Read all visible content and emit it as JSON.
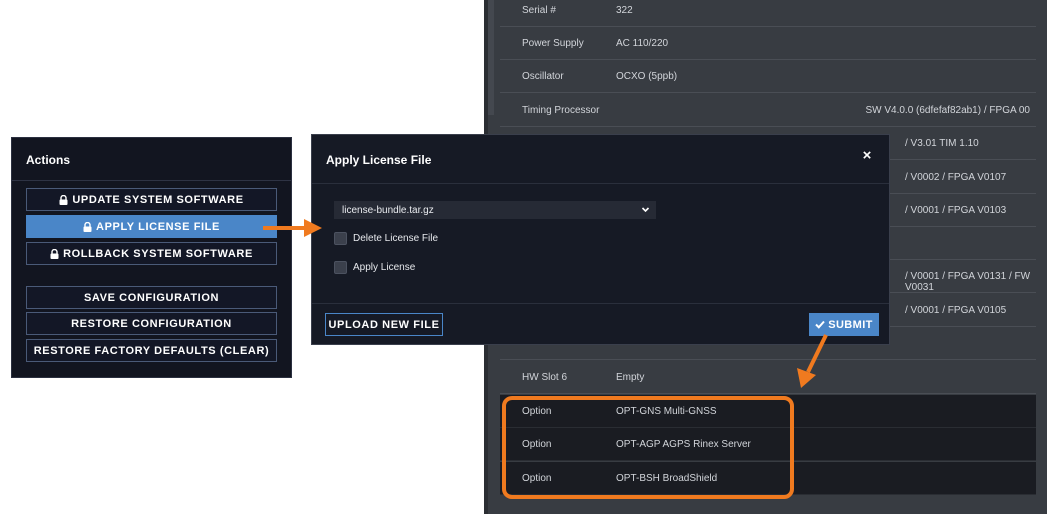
{
  "info_panel": {
    "rows": [
      {
        "label": "Serial #",
        "value": "322",
        "extra": ""
      },
      {
        "label": "Power Supply",
        "value": "AC 110/220",
        "extra": ""
      },
      {
        "label": "Oscillator",
        "value": "OCXO (5ppb)",
        "extra": ""
      },
      {
        "label": "Timing Processor",
        "value": "",
        "extra": "SW V4.0.0 (6dfefaf82ab1) / FPGA 00"
      },
      {
        "label": "",
        "value": "",
        "extra": "/ V3.01 TIM 1.10"
      },
      {
        "label": "",
        "value": "",
        "extra": "/ V0002 / FPGA V0107"
      },
      {
        "label": "",
        "value": "",
        "extra": "/ V0001 / FPGA V0103"
      },
      {
        "label": "",
        "value": "",
        "extra": ""
      },
      {
        "label": "",
        "value": "",
        "extra": "/ V0001 / FPGA V0131 / FW V0031"
      },
      {
        "label": "",
        "value": "",
        "extra": "/ V0001 / FPGA V0105"
      },
      {
        "label": "",
        "value": "",
        "extra": ""
      },
      {
        "label": "HW Slot 6",
        "value": "Empty",
        "extra": ""
      }
    ],
    "options": [
      {
        "label": "Option",
        "value": "OPT-GNS Multi-GNSS"
      },
      {
        "label": "Option",
        "value": "OPT-AGP AGPS Rinex Server"
      },
      {
        "label": "Option",
        "value": "OPT-BSH BroadShield"
      }
    ]
  },
  "actions": {
    "title": "Actions",
    "buttons": [
      {
        "label": "UPDATE SYSTEM SOFTWARE",
        "icon": "lock-icon"
      },
      {
        "label": "APPLY LICENSE FILE",
        "icon": "lock-icon",
        "active": true
      },
      {
        "label": "ROLLBACK SYSTEM SOFTWARE",
        "icon": "lock-icon"
      },
      {
        "label": "SAVE CONFIGURATION"
      },
      {
        "label": "RESTORE CONFIGURATION"
      },
      {
        "label": "RESTORE FACTORY DEFAULTS (CLEAR)"
      }
    ]
  },
  "modal": {
    "title": "Apply License File",
    "close_icon": "×",
    "select_value": "license-bundle.tar.gz",
    "checkboxes": [
      {
        "label": "Delete License File",
        "checked": false
      },
      {
        "label": "Apply License",
        "checked": false
      }
    ],
    "upload_label": "UPLOAD NEW FILE",
    "submit_label": "SUBMIT",
    "submit_icon": "check-icon"
  },
  "colors": {
    "accent": "#4a86c8",
    "highlight": "#f07a1f",
    "panel_dark": "#121520",
    "info_bg": "#383c42"
  }
}
